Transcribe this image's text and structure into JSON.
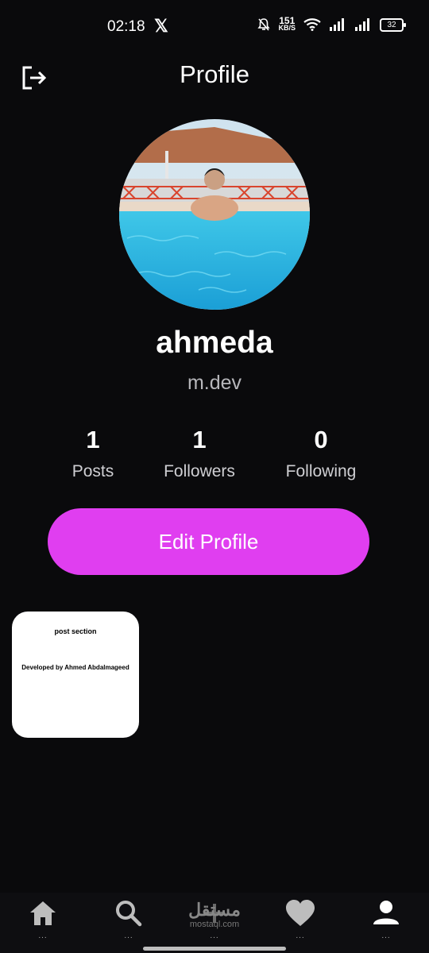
{
  "status_bar": {
    "time": "02:18",
    "x_app": "𝕏",
    "net_speed_value": "151",
    "net_speed_unit": "KB/S",
    "battery": "32"
  },
  "header": {
    "title": "Profile"
  },
  "profile": {
    "username": "ahmeda",
    "handle": "m.dev"
  },
  "stats": [
    {
      "value": "1",
      "label": "Posts"
    },
    {
      "value": "1",
      "label": "Followers"
    },
    {
      "value": "0",
      "label": "Following"
    }
  ],
  "edit_button": "Edit Profile",
  "post": {
    "title": "post section",
    "body": "Developed by Ahmed Abdalmageed"
  },
  "bottom_nav": {
    "items": [
      "home-icon",
      "search-icon",
      "add-icon",
      "heart-icon",
      "profile-icon"
    ],
    "dots": "...",
    "watermark_brand": "مستقل",
    "watermark_site": "mostaql.com"
  },
  "colors": {
    "accent": "#e03ef0",
    "background": "#0a0a0c"
  }
}
